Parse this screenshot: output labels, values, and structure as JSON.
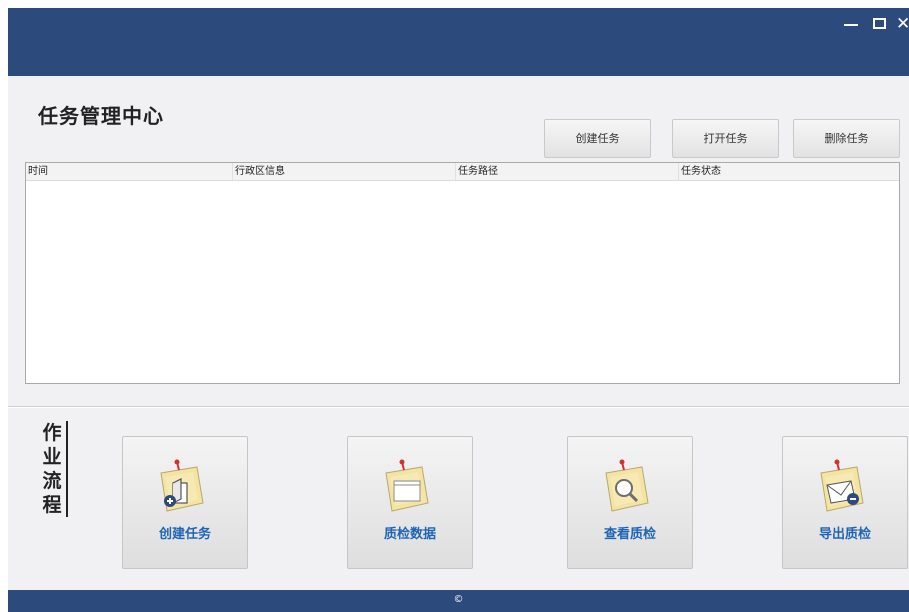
{
  "window": {
    "controls": {
      "minimize_icon": "minimize-icon",
      "maximize_icon": "maximize-icon",
      "close_label": "✕"
    }
  },
  "header": {
    "title": "任务管理中心"
  },
  "toolbar": {
    "create_label": "创建任务",
    "open_label": "打开任务",
    "delete_label": "删除任务"
  },
  "table": {
    "columns": [
      "时间",
      "行政区信息",
      "任务路径",
      "任务状态"
    ],
    "rows": []
  },
  "workflow": {
    "title_chars": [
      "作",
      "业",
      "流",
      "程"
    ],
    "items": [
      {
        "label": "创建任务",
        "icon": "create-task-icon"
      },
      {
        "label": "质检数据",
        "icon": "inspect-data-icon"
      },
      {
        "label": "查看质检",
        "icon": "view-inspection-icon"
      },
      {
        "label": "导出质检",
        "icon": "export-inspection-icon"
      }
    ]
  },
  "footer": {
    "copyright": "©"
  },
  "colors": {
    "header": "#2d4a7d",
    "accent_text": "#1f65b5",
    "note_paper": "#f3e3a4",
    "pin": "#d33030"
  }
}
